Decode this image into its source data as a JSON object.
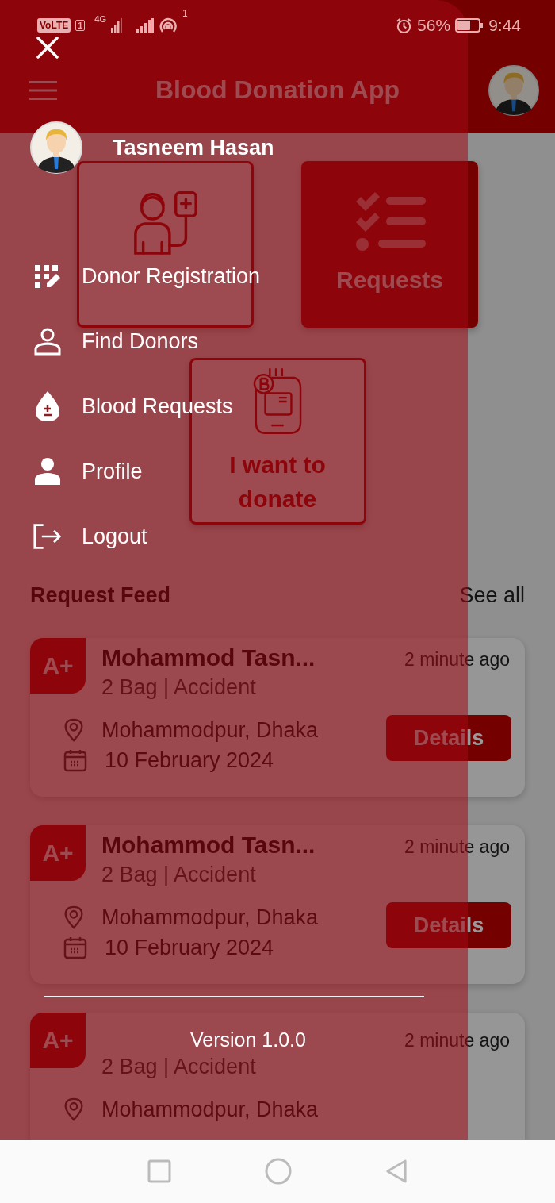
{
  "status_bar": {
    "network": "VoLTE",
    "sim": "1",
    "mobile": "4G",
    "hotspot_count": "1",
    "battery": "56%",
    "time": "9:44"
  },
  "app_bar": {
    "title": "Blood Donation App"
  },
  "tiles": [
    {
      "selected": false
    },
    {
      "label": "Requests",
      "selected": true
    },
    {
      "label": "I want to donate",
      "selected": false
    }
  ],
  "feed": {
    "title": "Request Feed",
    "link": "See all",
    "cards": [
      {
        "blood_group": "A+",
        "name": "Mohammod Tasn...",
        "time": "2 minute ago",
        "details": "2 Bag | Accident",
        "location": "Mohammodpur, Dhaka",
        "date": "10 February 2024",
        "button": "Details"
      },
      {
        "blood_group": "A+",
        "name": "Mohammod Tasn...",
        "time": "2 minute ago",
        "details": "2 Bag | Accident",
        "location": "Mohammodpur, Dhaka",
        "date": "10 February 2024",
        "button": "Details"
      },
      {
        "blood_group": "A+",
        "time": "2 minute ago",
        "details": "2 Bag | Accident",
        "location": "Mohammodpur, Dhaka"
      }
    ]
  },
  "drawer": {
    "user": "Tasneem Hasan",
    "menu": [
      "Donor Registration",
      "Find Donors",
      "Blood Requests",
      "Profile",
      "Logout"
    ],
    "version": "Version 1.0.0"
  }
}
